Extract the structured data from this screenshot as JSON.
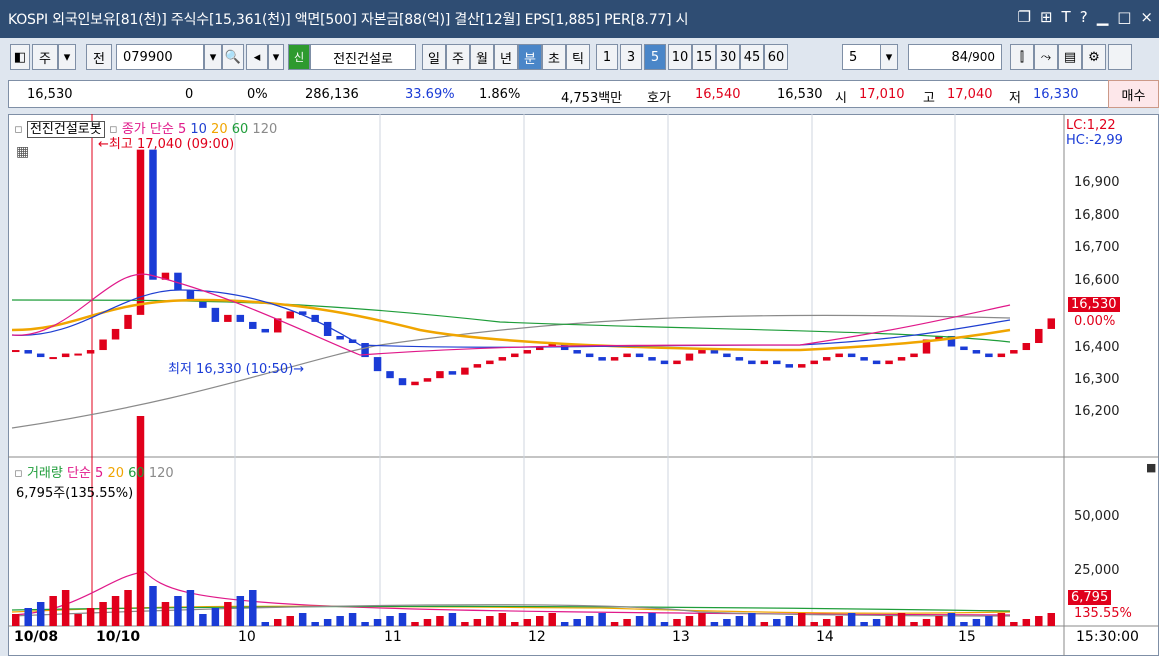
{
  "titlebar": {
    "text": "KOSPI 외국인보유[81(천)] 주식수[15,361(천)] 액면[500] 자본금[88(억)] 결산[12월] EPS[1,885] PER[8.77] 시",
    "icons": [
      "□",
      "⧉",
      "🖈",
      "T",
      "?",
      "|",
      "_",
      "□",
      "×"
    ]
  },
  "toolbar": {
    "jong": "주",
    "jeon": "전",
    "code": "079900",
    "stock_badge": "신",
    "stock_name": "전진건설로",
    "periods": [
      "일",
      "주",
      "월",
      "년"
    ],
    "period_sel": "분",
    "period_more": [
      "초",
      "틱"
    ],
    "intervals": [
      "1",
      "3",
      "5",
      "10",
      "15",
      "30",
      "45",
      "60"
    ],
    "interval_selected": "5",
    "count_value": "5",
    "view_count": "84",
    "view_total": "/900"
  },
  "info": {
    "price": "16,530",
    "change": "0",
    "rate": "0%",
    "volume": "286,136",
    "turnover": "33.69%",
    "foreign_rate": "1.86%",
    "amount": "4,753백만",
    "hoga_label": "호가",
    "ask": "16,540",
    "bid": "16,530",
    "open_label": "시",
    "open": "17,010",
    "high_label": "고",
    "high": "17,040",
    "low_label": "저",
    "low": "16,330",
    "buy_button": "매수"
  },
  "price_chart": {
    "title": "전진건설로봇",
    "legend_prefix": "종가 단순",
    "ma": [
      {
        "label": "5",
        "color": "#e0198a"
      },
      {
        "label": "10",
        "color": "#1f3fd1"
      },
      {
        "label": "20",
        "color": "#f0a500"
      },
      {
        "label": "60",
        "color": "#1f9d3a"
      },
      {
        "label": "120",
        "color": "#8a8a8a"
      }
    ],
    "high_note": "←최고 17,040 (09:00)",
    "low_note": "최저 16,330 (10:50)→",
    "lc": "LC:1,22",
    "hc": "HC:-2,99",
    "yticks": [
      "16,900",
      "16,800",
      "16,700",
      "16,600",
      "16,500",
      "16,400",
      "16,300",
      "16,200"
    ],
    "cur_price_badge": "16,530",
    "cur_pct": "0.00%"
  },
  "volume_chart": {
    "title": "거래량",
    "legend_prefix": "단순",
    "ma": [
      {
        "label": "5",
        "color": "#e0198a"
      },
      {
        "label": "20",
        "color": "#f0a500"
      },
      {
        "label": "60",
        "color": "#1f9d3a"
      },
      {
        "label": "120",
        "color": "#8a8a8a"
      }
    ],
    "info": "6,795주(135.55%)",
    "yticks": [
      "50,000",
      "25,000"
    ],
    "badge": "6,795",
    "badge_pct": "135.55%"
  },
  "xaxis": {
    "labels": [
      "10/08",
      "10/10",
      "10",
      "11",
      "12",
      "13",
      "14",
      "15"
    ],
    "time": "15:30:00"
  },
  "chart_data": {
    "type": "candlestick",
    "interval": "5",
    "y_range": [
      16150,
      17100
    ],
    "high": 17040,
    "low": 16330,
    "close": 16530,
    "volume_latest": 6795
  }
}
